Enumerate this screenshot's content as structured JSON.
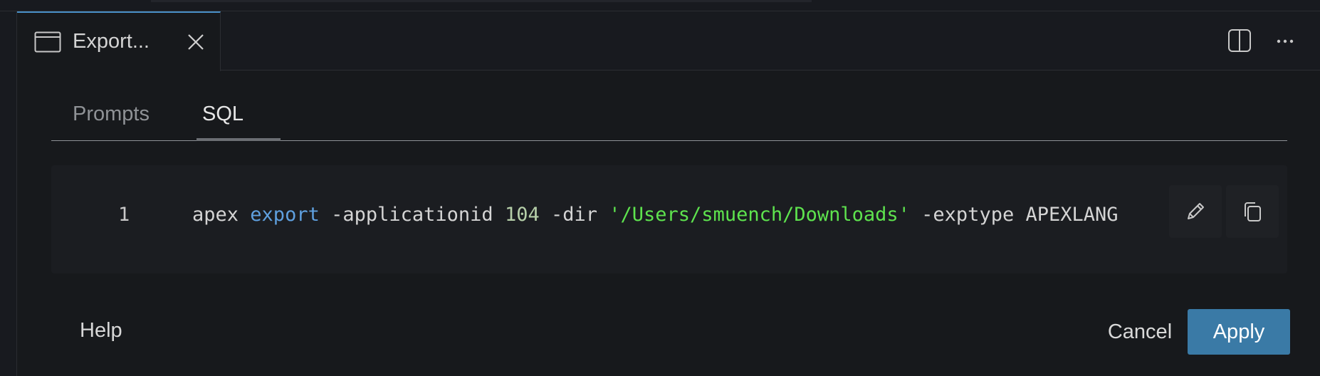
{
  "tab": {
    "title": "Export..."
  },
  "subtabs": [
    {
      "label": "Prompts",
      "active": false
    },
    {
      "label": "SQL",
      "active": true
    }
  ],
  "code": {
    "line_number": "1",
    "tokens": [
      {
        "text": "apex",
        "kind": "plain"
      },
      {
        "text": " ",
        "kind": "plain"
      },
      {
        "text": "export",
        "kind": "keyword"
      },
      {
        "text": " -applicationid ",
        "kind": "plain"
      },
      {
        "text": "104",
        "kind": "number"
      },
      {
        "text": " -dir ",
        "kind": "plain"
      },
      {
        "text": "'/Users/smuench/Downloads'",
        "kind": "string"
      },
      {
        "text": " -exptype APEXLANG",
        "kind": "plain"
      }
    ]
  },
  "footer": {
    "help_label": "Help",
    "cancel_label": "Cancel",
    "apply_label": "Apply"
  },
  "colors": {
    "accent": "#4a90c8",
    "apply_button": "#3a7aa6",
    "keyword": "#5fa0df",
    "string": "#5ee34e",
    "number": "#b5cea8"
  },
  "icons": {
    "tab": "window-icon",
    "close": "close-icon",
    "split": "split-editor-icon",
    "more": "more-actions-icon",
    "edit": "pencil-icon",
    "copy": "copy-icon"
  }
}
